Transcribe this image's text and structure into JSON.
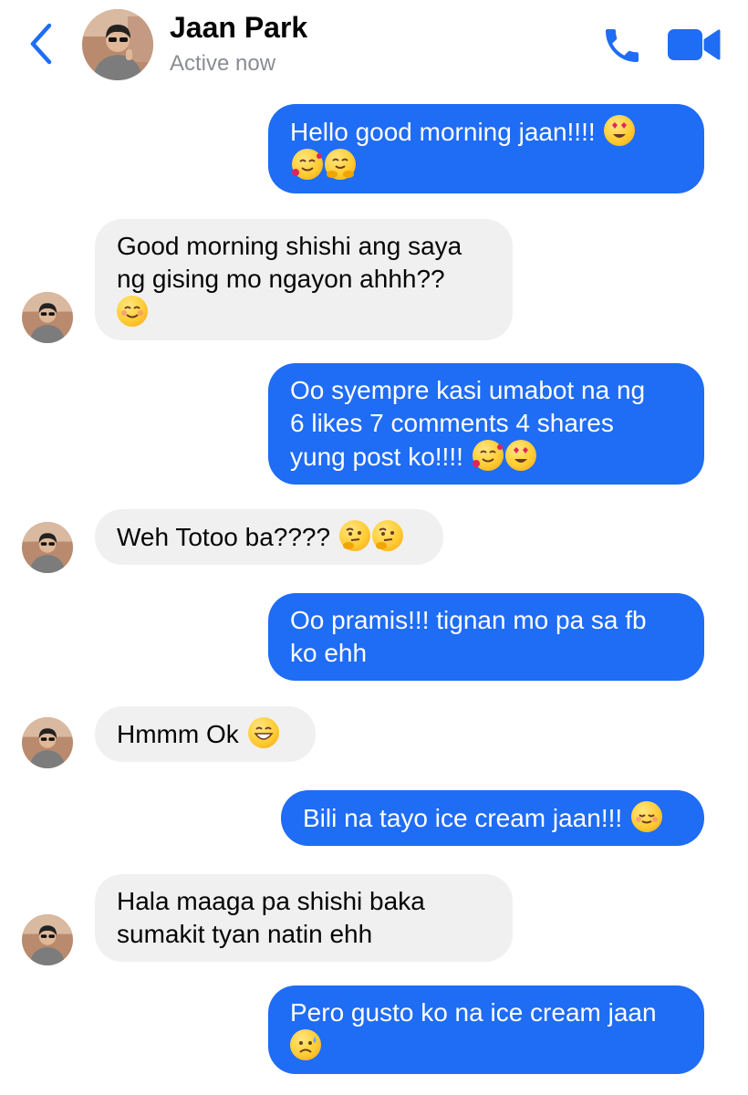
{
  "header": {
    "name": "Jaan Park",
    "status": "Active now"
  },
  "colors": {
    "accent": "#1f6cf5",
    "incoming_bubble": "#f0f0f0"
  },
  "icons": {
    "back": "chevron-left-icon",
    "call": "phone-icon",
    "video": "video-camera-icon"
  },
  "messages": [
    {
      "direction": "out",
      "lines": [
        "Hello good morning jaan!!!!"
      ],
      "emojis": [
        "heart-eyes",
        "smiling-hearts",
        "hugging"
      ]
    },
    {
      "direction": "in",
      "lines": [
        "Good morning shishi ang saya",
        "ng gising mo ngayon ahhh??"
      ],
      "emojis": [
        "smiling-blush"
      ]
    },
    {
      "direction": "out",
      "lines": [
        "Oo syempre kasi umabot na ng",
        "6 likes 7 comments 4 shares",
        "yung post ko!!!!"
      ],
      "emojis": [
        "smiling-hearts",
        "heart-eyes"
      ]
    },
    {
      "direction": "in",
      "lines": [
        "Weh Totoo ba????"
      ],
      "emojis": [
        "thinking",
        "thinking"
      ]
    },
    {
      "direction": "out",
      "lines": [
        "Oo pramis!!! tignan mo pa sa fb",
        "ko ehh"
      ],
      "emojis": []
    },
    {
      "direction": "in",
      "lines": [
        "Hmmm Ok"
      ],
      "emojis": [
        "grinning"
      ]
    },
    {
      "direction": "out",
      "lines": [
        "Bili na tayo ice cream jaan!!!"
      ],
      "emojis": [
        "relieved-blush"
      ]
    },
    {
      "direction": "in",
      "lines": [
        "Hala maaga pa shishi baka",
        "sumakit tyan natin ehh"
      ],
      "emojis": []
    },
    {
      "direction": "out",
      "lines": [
        "Pero gusto ko na ice cream jaan"
      ],
      "emojis": [
        "sad-sweat"
      ]
    }
  ]
}
